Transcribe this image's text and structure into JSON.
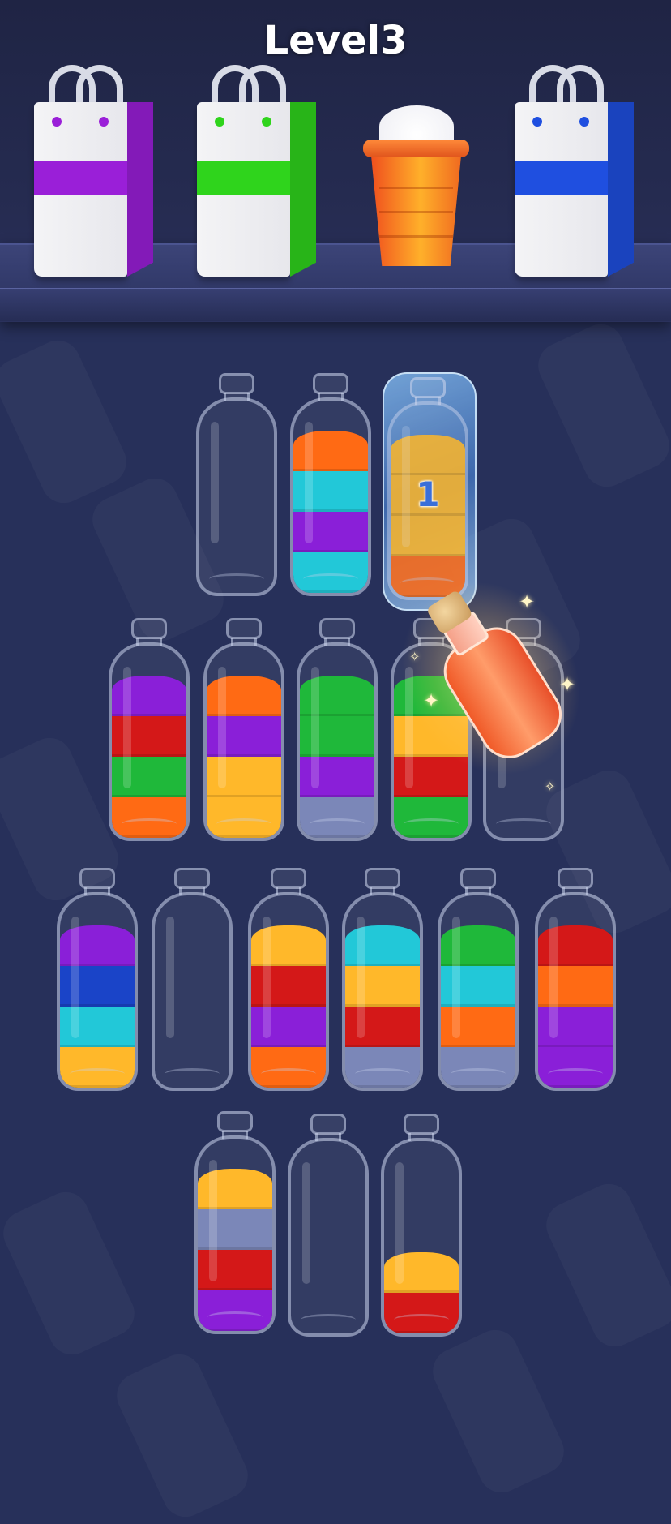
{
  "level_title": "Level3",
  "icons": {
    "bag": "shopping-bag-icon",
    "cup": "drink-cup-icon",
    "potion": "magic-potion-icon",
    "sparkle": "sparkle-icon"
  },
  "targets": [
    {
      "type": "bag",
      "color": "#9a1fd8"
    },
    {
      "type": "bag",
      "color": "#2fd41c"
    },
    {
      "type": "cup",
      "color": "#f06a20"
    },
    {
      "type": "bag",
      "color": "#1f4fe0"
    }
  ],
  "colors": {
    "orange": "#ff6a14",
    "cyan": "#22c8d8",
    "purple": "#8a1fd8",
    "yellow": "#ffb82a",
    "red": "#d41818",
    "green": "#1fb83a",
    "blue": "#1a44c8",
    "slate": "#7b87b8"
  },
  "bottles": [
    {
      "id": "b1",
      "layers": []
    },
    {
      "id": "b2",
      "layers": [
        "cyan",
        "purple",
        "cyan",
        "orange"
      ]
    },
    {
      "id": "b3",
      "frozen": true,
      "lock_count": "1",
      "layers": [
        "orange",
        "yellow",
        "yellow",
        "yellow"
      ]
    },
    {
      "id": "b4",
      "layers": [
        "orange",
        "green",
        "red",
        "purple"
      ]
    },
    {
      "id": "b5",
      "layers": [
        "yellow",
        "yellow",
        "purple",
        "orange"
      ]
    },
    {
      "id": "b6",
      "layers": [
        "slate",
        "purple",
        "green",
        "green"
      ]
    },
    {
      "id": "b7",
      "layers": [
        "green",
        "red",
        "yellow",
        "green"
      ]
    },
    {
      "id": "b8",
      "layers": []
    },
    {
      "id": "b9",
      "layers": [
        "yellow",
        "cyan",
        "blue",
        "purple"
      ]
    },
    {
      "id": "b10",
      "layers": []
    },
    {
      "id": "b11",
      "layers": [
        "orange",
        "purple",
        "red",
        "yellow"
      ]
    },
    {
      "id": "b12",
      "layers": [
        "slate",
        "red",
        "yellow",
        "cyan"
      ]
    },
    {
      "id": "b13",
      "layers": [
        "slate",
        "orange",
        "cyan",
        "green"
      ]
    },
    {
      "id": "b14",
      "layers": [
        "purple",
        "purple",
        "orange",
        "red"
      ]
    },
    {
      "id": "b15",
      "layers": [
        "purple",
        "red",
        "slate",
        "yellow"
      ]
    },
    {
      "id": "b16",
      "layers": []
    },
    {
      "id": "b17",
      "layers": [
        "red",
        "yellow"
      ]
    }
  ]
}
